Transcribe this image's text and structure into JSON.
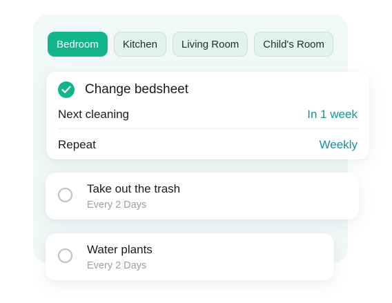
{
  "tabs": [
    {
      "label": "Bedroom",
      "active": true
    },
    {
      "label": "Kitchen",
      "active": false
    },
    {
      "label": "Living Room",
      "active": false
    },
    {
      "label": "Child's Room",
      "active": false
    }
  ],
  "main_task": {
    "title": "Change bedsheet",
    "completed": true,
    "rows": [
      {
        "label": "Next cleaning",
        "value": "In 1 week"
      },
      {
        "label": "Repeat",
        "value": "Weekly"
      }
    ]
  },
  "tasks": [
    {
      "title": "Take out the trash",
      "subtitle": "Every 2 Days",
      "completed": false
    },
    {
      "title": "Water plants",
      "subtitle": "Every 2 Days",
      "completed": false
    }
  ],
  "colors": {
    "accent": "#12b48a",
    "value_text": "#13939a",
    "panel_bg": "#f1f8f8",
    "tab_bg": "#e2f3ec"
  },
  "icons": {
    "completed": "check-circle-icon",
    "pending": "empty-circle-icon"
  }
}
